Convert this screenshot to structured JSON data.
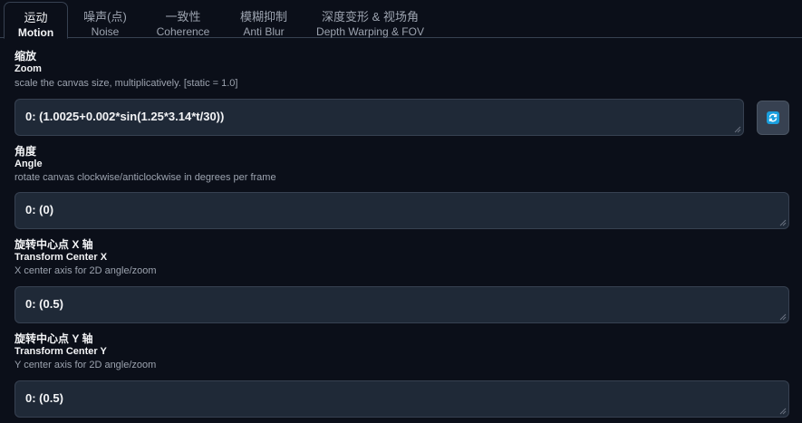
{
  "tabs": [
    {
      "zh": "运动",
      "en": "Motion",
      "active": true
    },
    {
      "zh": "噪声(点)",
      "en": "Noise",
      "active": false
    },
    {
      "zh": "一致性",
      "en": "Coherence",
      "active": false
    },
    {
      "zh": "模糊抑制",
      "en": "Anti Blur",
      "active": false
    },
    {
      "zh": "深度变形 & 视场角",
      "en": "Depth Warping & FOV",
      "active": false
    }
  ],
  "fields": {
    "zoom": {
      "title_zh": "缩放",
      "title_en": "Zoom",
      "description": "scale the canvas size, multiplicatively. [static = 1.0]",
      "value": "0: (1.0025+0.002*sin(1.25*3.14*t/30))"
    },
    "angle": {
      "title_zh": "角度",
      "title_en": "Angle",
      "description": "rotate canvas clockwise/anticlockwise in degrees per frame",
      "value": "0: (0)"
    },
    "transform_center_x": {
      "title_zh": "旋转中心点 X 轴",
      "title_en": "Transform Center X",
      "description": "X center axis for 2D angle/zoom",
      "value": "0: (0.5)"
    },
    "transform_center_y": {
      "title_zh": "旋转中心点 Y 轴",
      "title_en": "Transform Center Y",
      "description": "Y center axis for 2D angle/zoom",
      "value": "0: (0.5)"
    }
  },
  "icons": {
    "refresh": "refresh-icon"
  },
  "colors": {
    "background": "#0b0f19",
    "input_bg": "#1f2937",
    "accent": "#1a9fde"
  }
}
